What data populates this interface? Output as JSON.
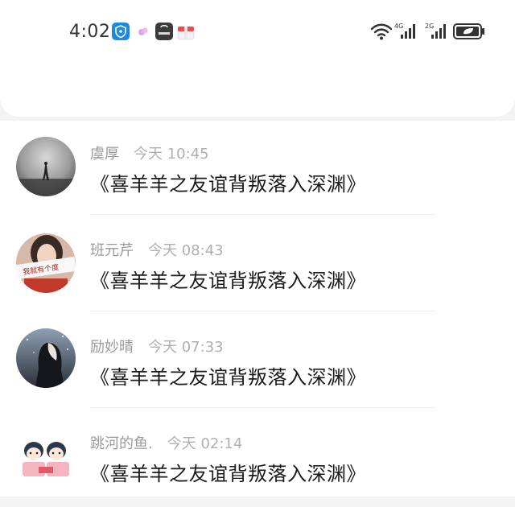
{
  "status_bar": {
    "time": "4:02",
    "icons": [
      "shield-app-icon",
      "candy-app-icon",
      "huawei-store-icon",
      "gift-box-icon"
    ],
    "right_icons": [
      "wifi-icon",
      "signal-4g-icon",
      "signal-2g-icon",
      "battery-icon"
    ],
    "net1": "4G",
    "net2": "2G"
  },
  "comments": [
    {
      "name": "虞厚",
      "time": "今天 10:45",
      "text": "《喜羊羊之友谊背叛落入深渊》"
    },
    {
      "name": "班元芹",
      "time": "今天 08:43",
      "text": "《喜羊羊之友谊背叛落入深渊》"
    },
    {
      "name": "励妙晴",
      "time": "今天 07:33",
      "text": "《喜羊羊之友谊背叛落入深渊》"
    },
    {
      "name": "跳河的鱼.",
      "time": "今天 02:14",
      "text": "《喜羊羊之友谊背叛落入深渊》"
    }
  ],
  "avatar_caption": "我就有个度"
}
